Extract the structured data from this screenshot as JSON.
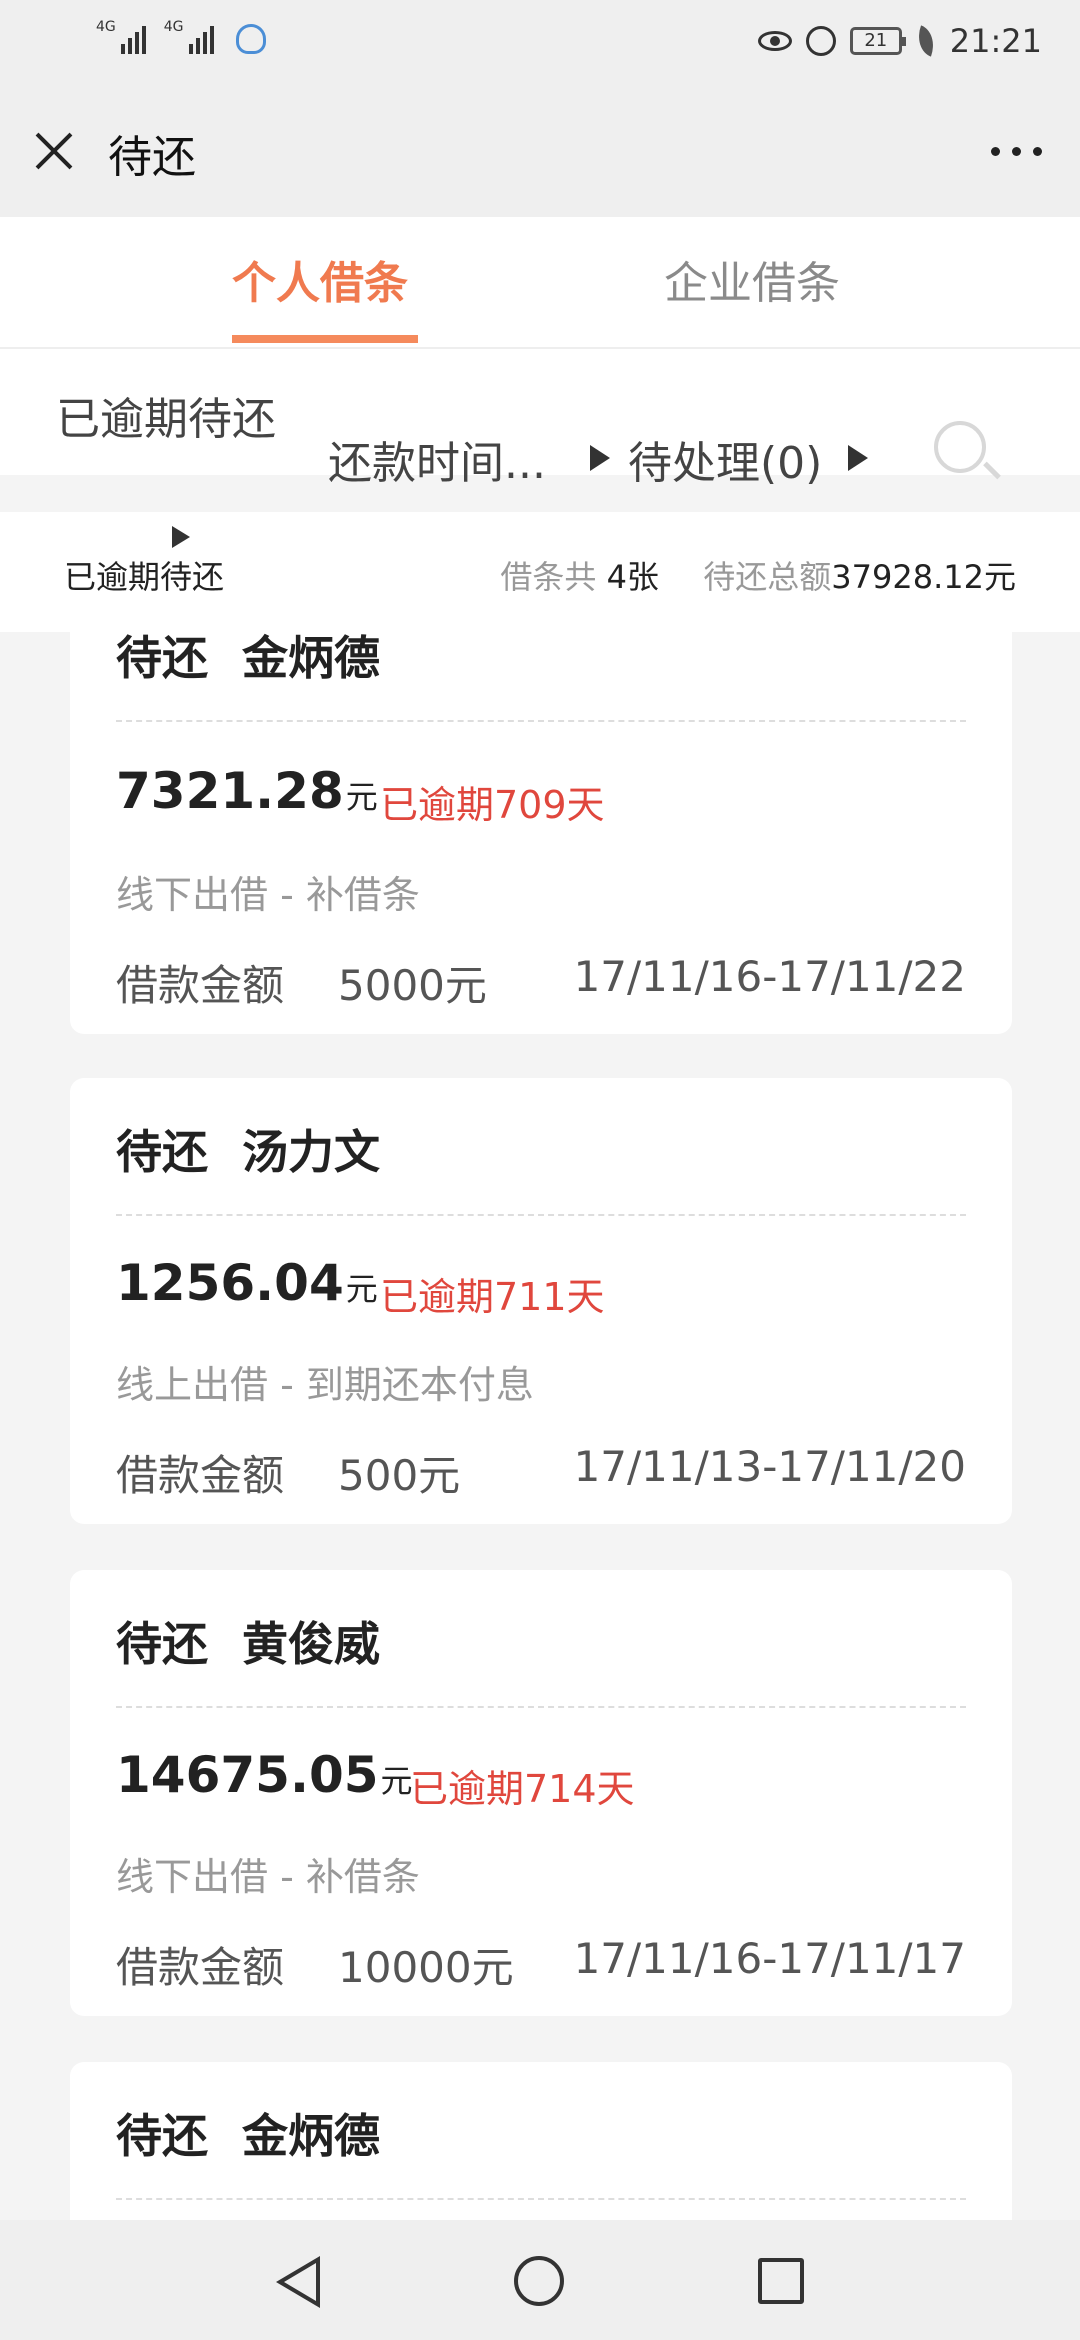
{
  "status_bar": {
    "signal1_tag": "4G",
    "signal2_tag": "4G",
    "battery": "21",
    "time": "21:21"
  },
  "header": {
    "title": "待还"
  },
  "tabs": [
    {
      "label": "个人借条",
      "active": true
    },
    {
      "label": "企业借条",
      "active": false
    }
  ],
  "filters": {
    "overdue": "已逾期待还",
    "time": "还款时间...",
    "pending": "待处理(0)"
  },
  "summary": {
    "filter_label": "已逾期待还",
    "count_label": "借条共",
    "count": "4张",
    "total_label": "待还总额",
    "total": "37928.12元"
  },
  "cards": [
    {
      "status": "待还",
      "name": "金炳德",
      "amount": "7321.28",
      "unit": "元",
      "overdue": "已逾期709天",
      "type": "线下出借 - 补借条",
      "loan_label": "借款金额",
      "loan_amount": "5000元",
      "dates": "17/11/16-17/11/22"
    },
    {
      "status": "待还",
      "name": "汤力文",
      "amount": "1256.04",
      "unit": "元",
      "overdue": "已逾期711天",
      "type": "线上出借 - 到期还本付息",
      "loan_label": "借款金额",
      "loan_amount": "500元",
      "dates": "17/11/13-17/11/20"
    },
    {
      "status": "待还",
      "name": "黄俊威",
      "amount": "14675.05",
      "unit": "元",
      "overdue": "已逾期714天",
      "type": "线下出借 - 补借条",
      "loan_label": "借款金额",
      "loan_amount": "10000元",
      "dates": "17/11/16-17/11/17"
    },
    {
      "status": "待还",
      "name": "金炳德"
    }
  ]
}
